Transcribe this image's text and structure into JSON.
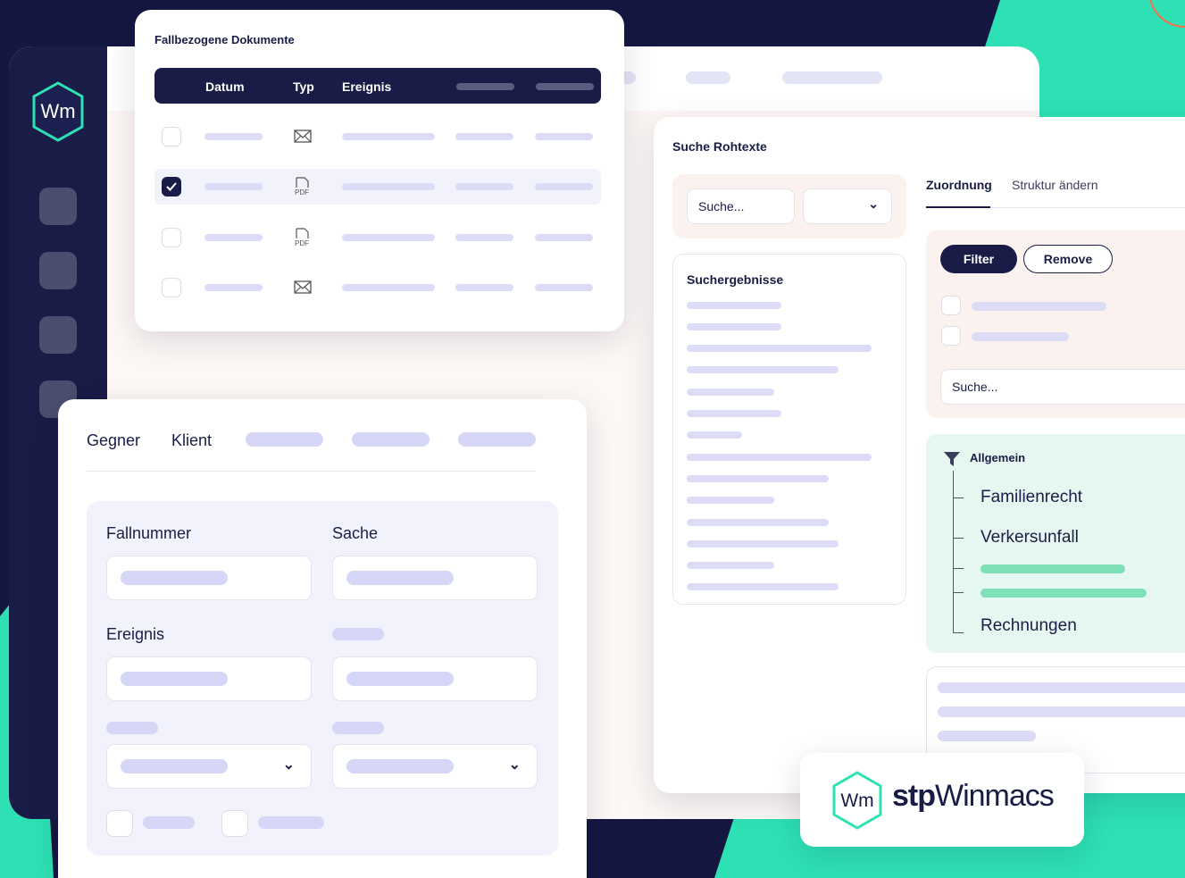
{
  "documents_card": {
    "title": "Fallbezogene Dokumente",
    "columns": [
      "Datum",
      "Typ",
      "Ereignis"
    ],
    "rows": [
      {
        "checked": false,
        "type_icon": "mail-icon"
      },
      {
        "checked": true,
        "type_icon": "pdf-icon",
        "type_label": "PDF"
      },
      {
        "checked": false,
        "type_icon": "pdf-icon",
        "type_label": "PDF"
      },
      {
        "checked": false,
        "type_icon": "mail-icon"
      }
    ]
  },
  "search_panel": {
    "title": "Suche Rohtexte",
    "search_placeholder": "Suche...",
    "results_title": "Suchergebnisse",
    "tabs": [
      "Zuordnung",
      "Struktur ändern"
    ],
    "active_tab": "Zuordnung",
    "filter_label": "Filter",
    "remove_label": "Remove",
    "filter_search_placeholder": "Suche...",
    "tree": {
      "root": "Allgemein",
      "items": [
        "Familienrecht",
        "Verkersunfall",
        "Rechnungen"
      ]
    }
  },
  "form_card": {
    "tabs": [
      "Gegner",
      "Klient"
    ],
    "fields": {
      "fallnummer": "Fallnummer",
      "sache": "Sache",
      "ereignis": "Ereignis"
    }
  },
  "logo": {
    "badge": "Wm",
    "brand_bold": "stp",
    "brand_light": "Winmacs"
  },
  "sidebar": {
    "logo": "Wm"
  },
  "colors": {
    "navy": "#191c46",
    "teal": "#2ee1b4",
    "panel_pink": "#fbf1ef",
    "mint": "#e6f7f1"
  }
}
